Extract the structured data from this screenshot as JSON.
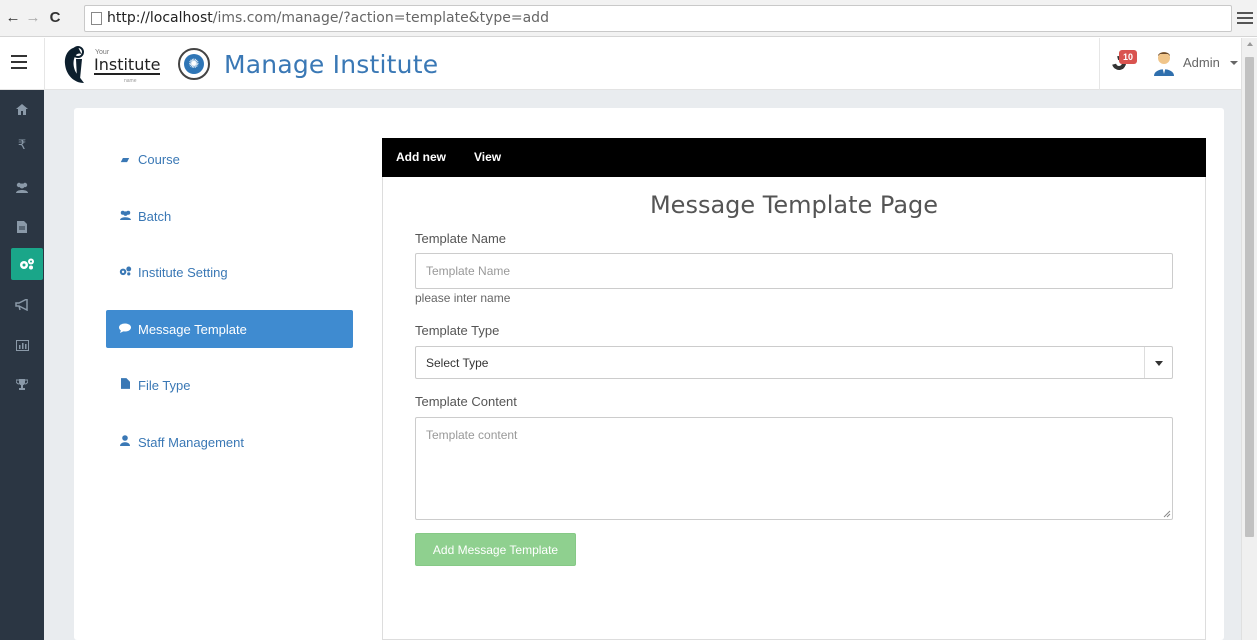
{
  "browser": {
    "url_host": "http://localhost",
    "url_path": "/ims.com/manage/?action=template&type=add"
  },
  "header": {
    "logo_small": "Your",
    "logo_main": "Institute",
    "logo_sub": "name",
    "title": "Manage Institute",
    "notification_count": "10",
    "user_name": "Admin"
  },
  "icon_sidebar": {
    "items": [
      "home-icon",
      "rupee-icon",
      "users-icon",
      "file-icon",
      "gears-icon",
      "bullhorn-icon",
      "bar-chart-icon",
      "trophy-icon"
    ],
    "active_index": 4,
    "active_color": "#1aa689"
  },
  "settings_menu": {
    "items": [
      {
        "label": "Course",
        "icon": "book-icon"
      },
      {
        "label": "Batch",
        "icon": "users-icon"
      },
      {
        "label": "Institute Setting",
        "icon": "gears-icon"
      },
      {
        "label": "Message Template",
        "icon": "comment-icon",
        "active": true
      },
      {
        "label": "File Type",
        "icon": "file-icon"
      },
      {
        "label": "Staff Management",
        "icon": "user-icon"
      }
    ],
    "active_color": "#3f8bd0"
  },
  "tabs": {
    "add_new": "Add new",
    "view": "View"
  },
  "form": {
    "title": "Message Template Page",
    "name_label": "Template Name",
    "name_placeholder": "Template Name",
    "name_help": "please inter name",
    "type_label": "Template Type",
    "type_selected": "Select Type",
    "content_label": "Template Content",
    "content_placeholder": "Template content",
    "submit_label": "Add Message Template",
    "submit_color": "#8fd08f"
  }
}
